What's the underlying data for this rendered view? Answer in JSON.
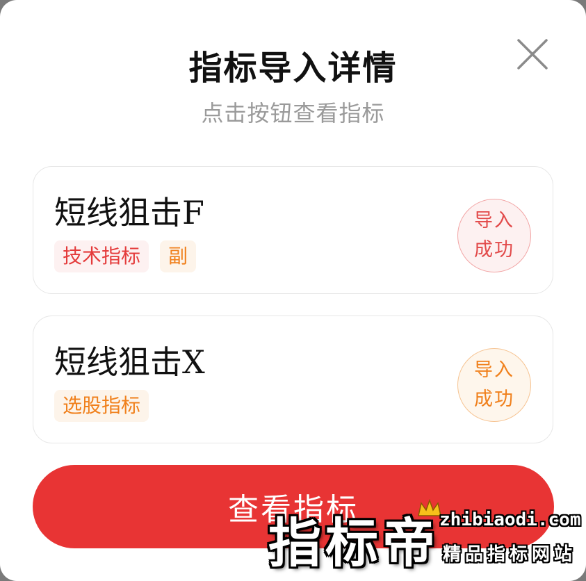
{
  "dialog": {
    "title": "指标导入详情",
    "subtitle": "点击按钮查看指标",
    "close_icon": "close-icon"
  },
  "indicators": [
    {
      "name": "短线狙击F",
      "tags": [
        {
          "label": "技术指标",
          "color": "#e43b3b"
        },
        {
          "label": "副",
          "color": "#f0801c"
        }
      ],
      "status_line1": "导入",
      "status_line2": "成功",
      "status_color": "#e24a4a"
    },
    {
      "name": "短线狙击X",
      "tags": [
        {
          "label": "选股指标",
          "color": "#f0801c"
        }
      ],
      "status_line1": "导入",
      "status_line2": "成功",
      "status_color": "#f0801c"
    }
  ],
  "actions": {
    "view_label": "查看指标",
    "accent": "#e83434"
  },
  "watermark": {
    "main": "指标帝",
    "domain": "zhibiaodi.com",
    "tagline": "精品指标网站"
  }
}
